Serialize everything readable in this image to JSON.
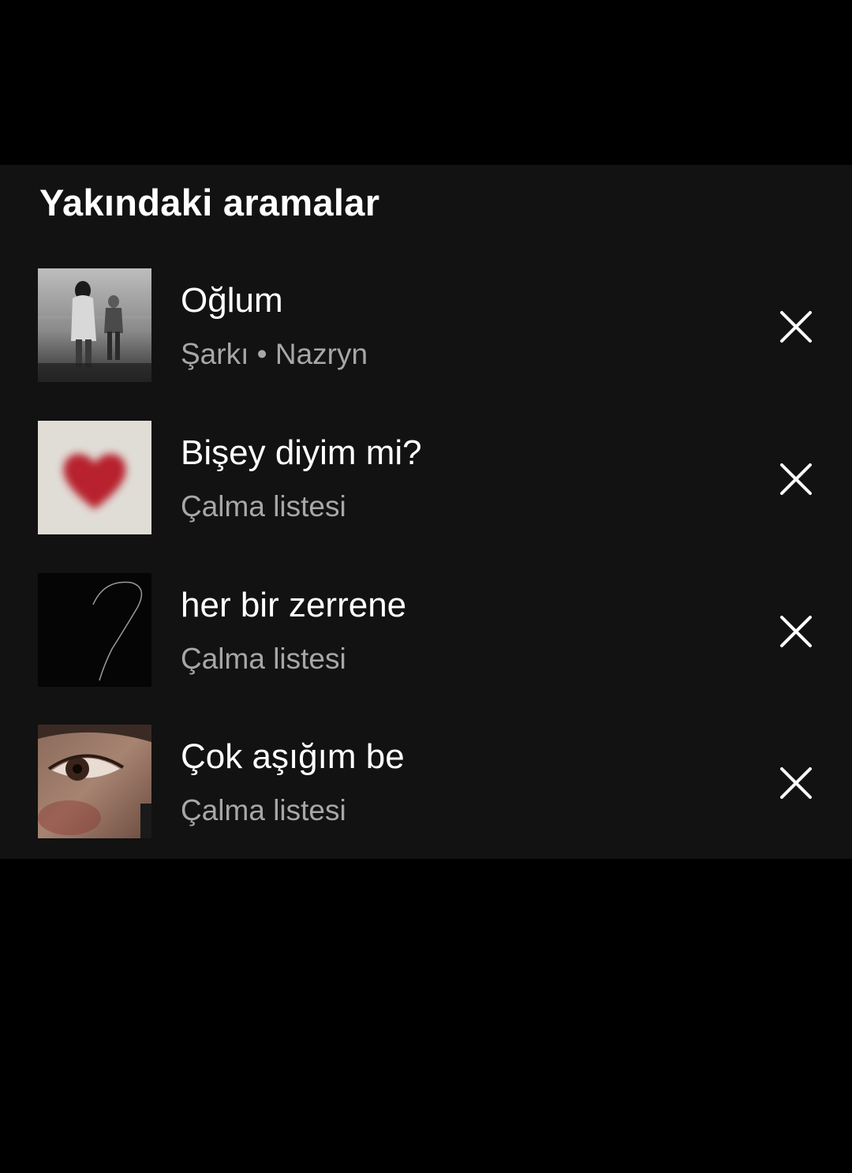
{
  "section": {
    "title": "Yakındaki aramalar"
  },
  "recent_searches": [
    {
      "title": "Oğlum",
      "subtitle": "Şarkı • Nazryn",
      "artwork": "mother-child-photo",
      "remove_icon": "close-icon"
    },
    {
      "title": "Bişey diyim mi?",
      "subtitle": "Çalma listesi",
      "artwork": "blurred-heart",
      "remove_icon": "close-icon"
    },
    {
      "title": "her bir zerrene",
      "subtitle": "Çalma listesi",
      "artwork": "question-mark-sketch",
      "remove_icon": "close-icon"
    },
    {
      "title": "Çok aşığım be",
      "subtitle": "Çalma listesi",
      "artwork": "eye-closeup",
      "remove_icon": "close-icon"
    }
  ],
  "colors": {
    "background": "#000000",
    "panel": "#121212",
    "text_primary": "#ffffff",
    "text_secondary": "#a7a7a7"
  }
}
